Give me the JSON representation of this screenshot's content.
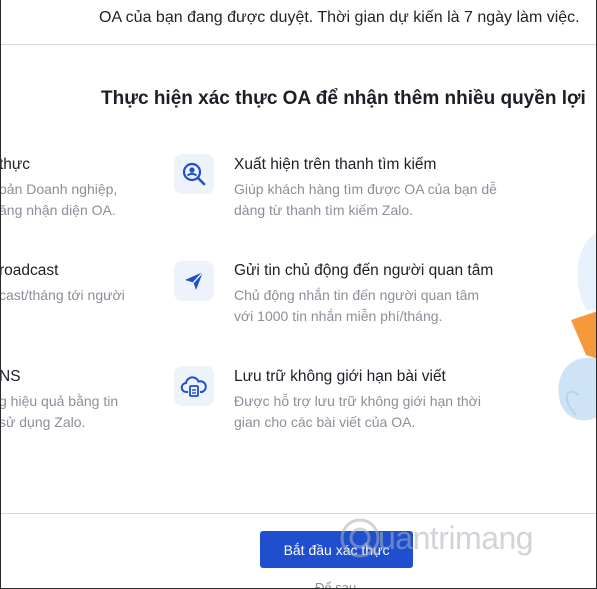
{
  "notice": {
    "text": "OA của bạn đang được duyệt. Thời gian dự kiến là 7 ngày làm việc."
  },
  "section": {
    "heading": "Thực hiện xác thực OA để nhận thêm nhiều quyền lợi"
  },
  "left_features": [
    {
      "title": "thực",
      "line1": "oản Doanh nghiệp,",
      "line2": "ăng nhận diện OA."
    },
    {
      "title": "roadcast",
      "line1": "cast/tháng tới người",
      "line2": ""
    },
    {
      "title": "NS",
      "line1": "g hiệu quả bằng tin",
      "line2": "sử dụng Zalo."
    }
  ],
  "right_features": [
    {
      "icon": "search-user-icon",
      "title": "Xuất hiện trên thanh tìm kiếm",
      "line1": "Giúp khách hàng tìm được OA của bạn dễ",
      "line2": "dàng từ thanh tìm kiếm Zalo."
    },
    {
      "icon": "send-icon",
      "title": "Gửi tin chủ động đến người quan tâm",
      "line1": "Chủ động nhắn tin đến người quan tâm",
      "line2": "với 1000 tin nhắn miễn phí/tháng."
    },
    {
      "icon": "cloud-storage-icon",
      "title": "Lưu trữ không giới hạn bài viết",
      "line1": "Được hỗ trợ lưu trữ không giới hạn thời",
      "line2": "gian cho các bài viết của OA."
    }
  ],
  "cta": {
    "label": "Bắt đầu xác thực"
  },
  "watermark": {
    "text": "uantrimang"
  },
  "bottom_note": {
    "text": "Để sau"
  },
  "colors": {
    "primary": "#1f4fcf",
    "icon_bg": "#eef2fb",
    "muted": "#8a9099",
    "decor_blue": "#cfe3f7",
    "decor_orange": "#f59a3b"
  }
}
